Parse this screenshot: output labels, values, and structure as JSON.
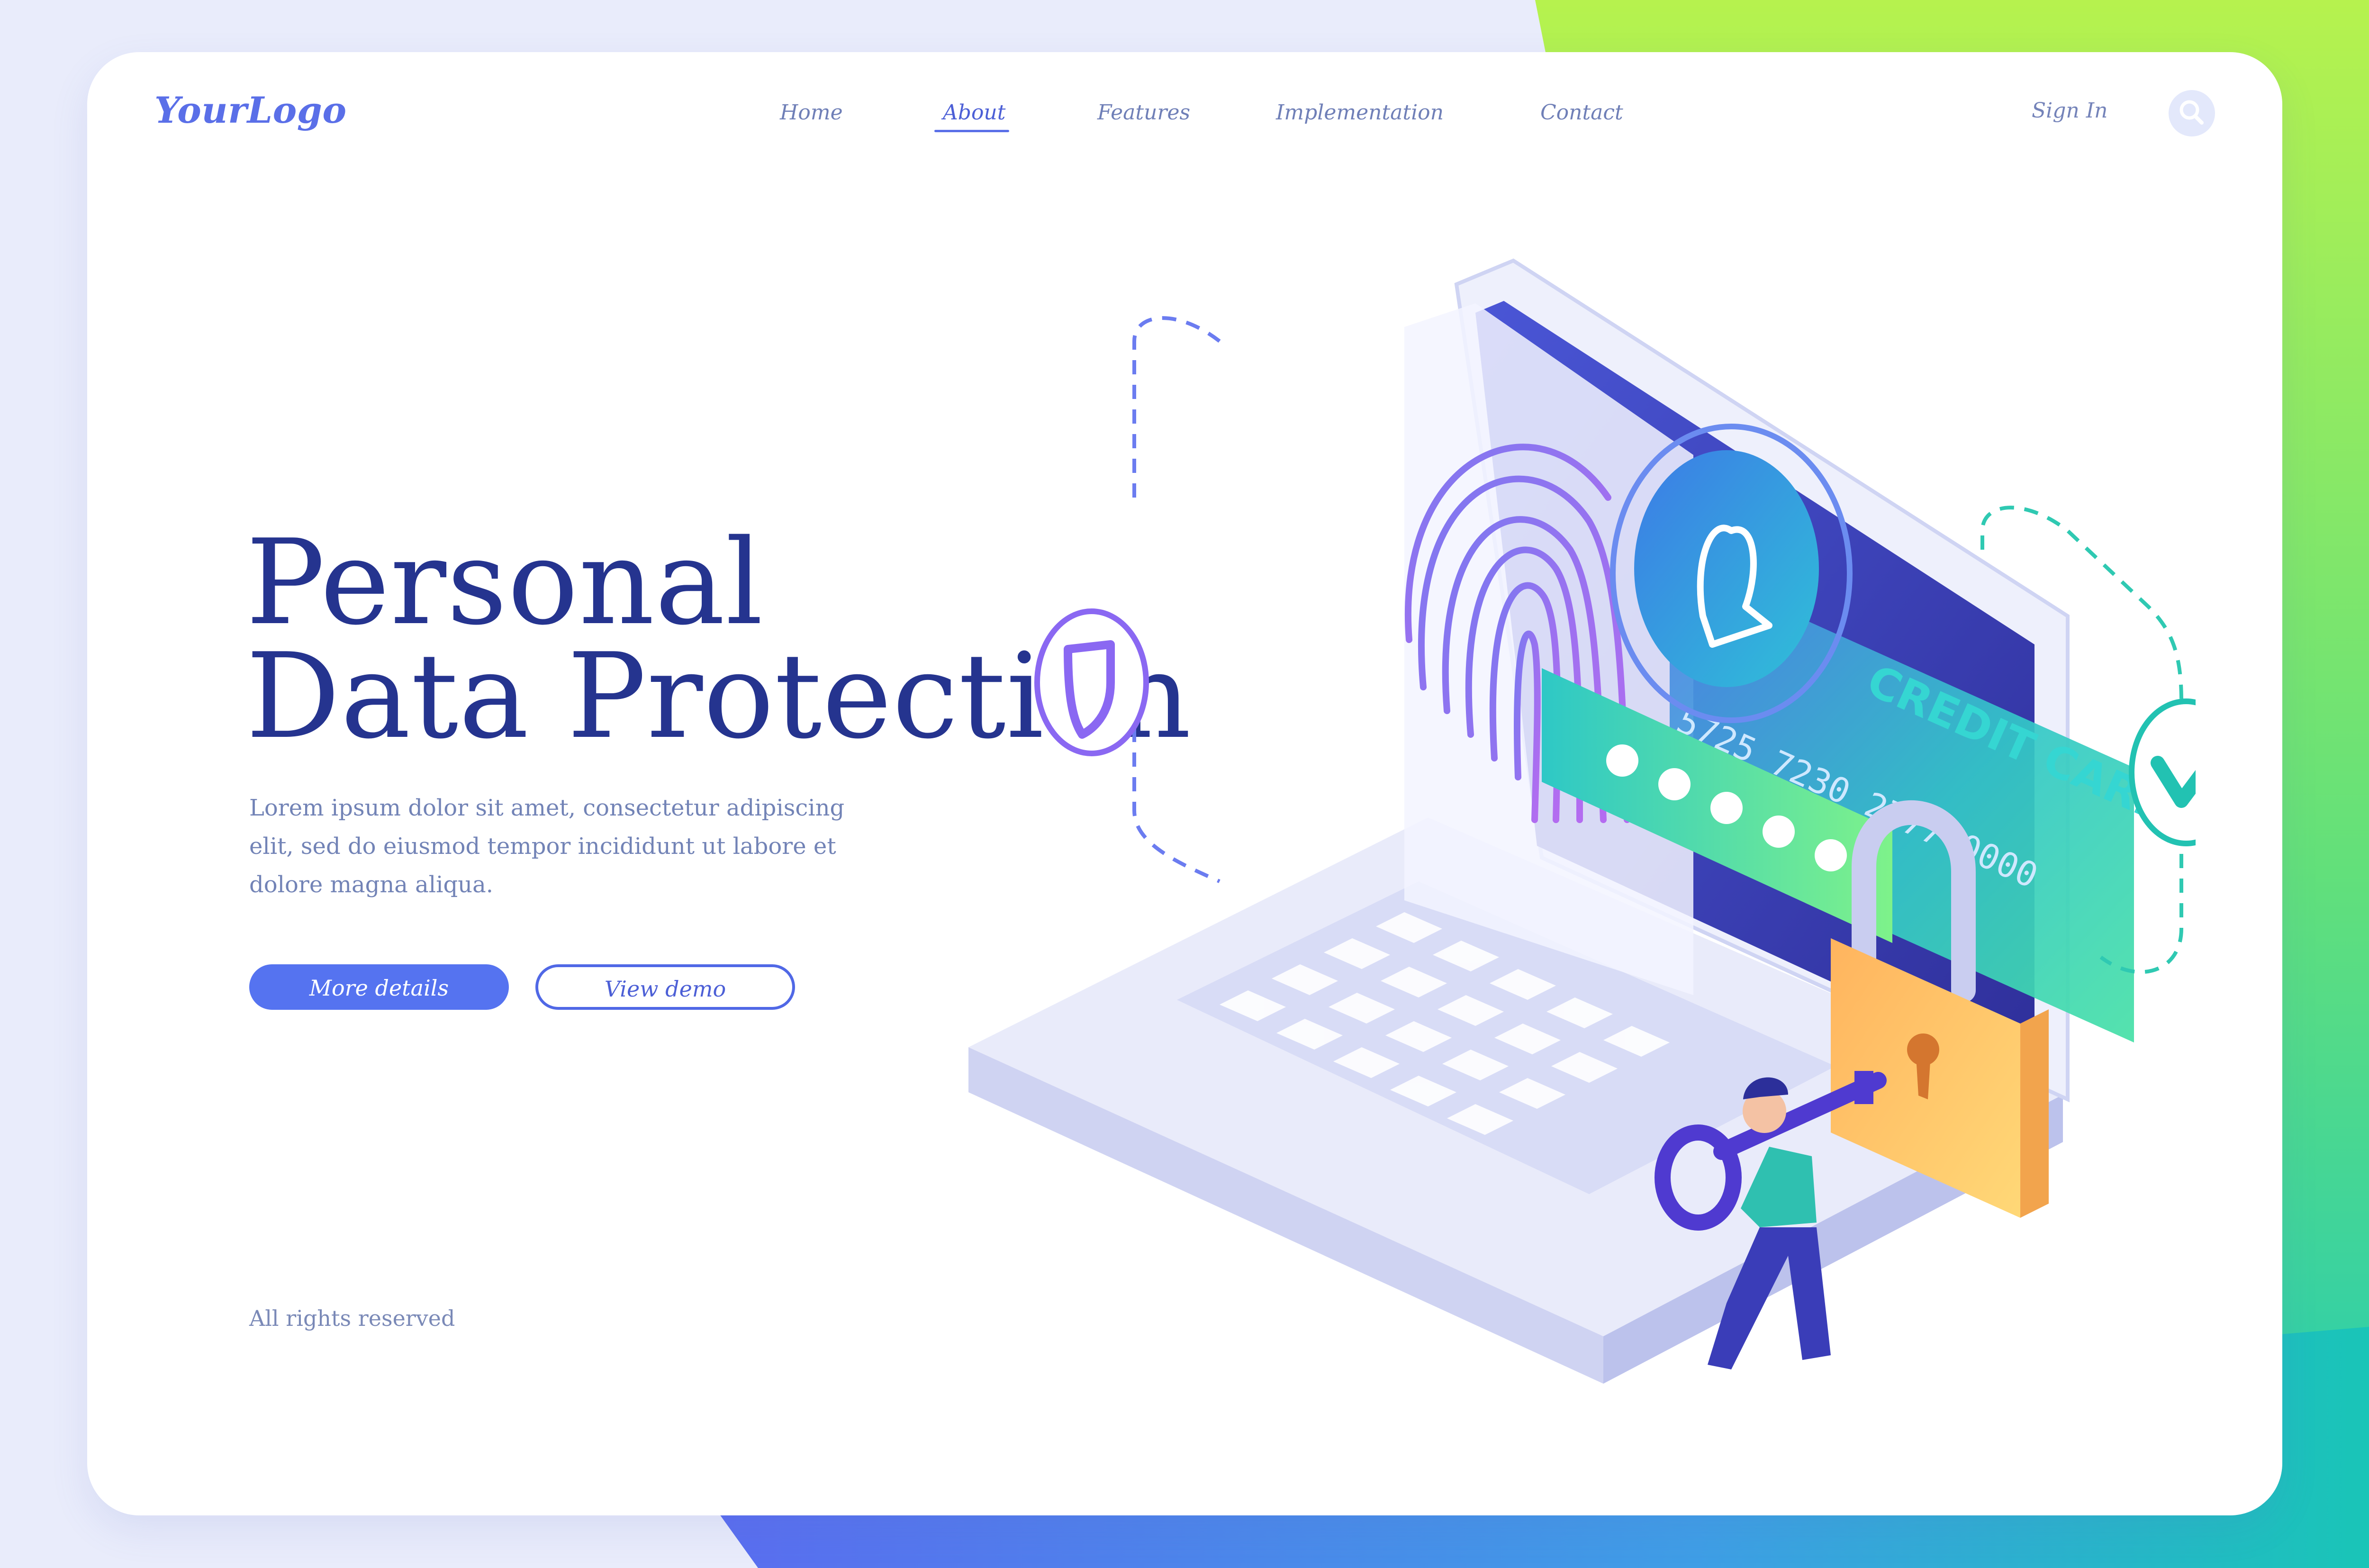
{
  "header": {
    "logo": "YourLogo",
    "nav": [
      {
        "label": "Home",
        "active": false
      },
      {
        "label": "About",
        "active": true
      },
      {
        "label": "Features",
        "active": false
      },
      {
        "label": "Implementation",
        "active": false
      },
      {
        "label": "Contact",
        "active": false
      }
    ],
    "sign_in": "Sign In",
    "search_icon": "search-icon"
  },
  "hero": {
    "title_line1": "Personal",
    "title_line2": "Data Protection",
    "description": "Lorem ipsum dolor sit amet, consectetur adipiscing elit, sed do eiusmod tempor incididunt ut labore et dolore magna aliqua.",
    "primary_button": "More details",
    "secondary_button": "View demo"
  },
  "illustration": {
    "card_label": "CREDIT CARD",
    "card_number": "5725 7230 2777 0000",
    "icons": [
      "fingerprint-icon",
      "user-avatar-icon",
      "shield-icon",
      "checkmark-icon",
      "padlock-icon",
      "key-icon",
      "laptop-icon"
    ]
  },
  "footer": {
    "text": "All rights reserved"
  },
  "colors": {
    "primary": "#5573f0",
    "title": "#25348f",
    "text": "#7283b6",
    "accent_green": "#9ef04a",
    "accent_teal": "#22c9b6"
  }
}
